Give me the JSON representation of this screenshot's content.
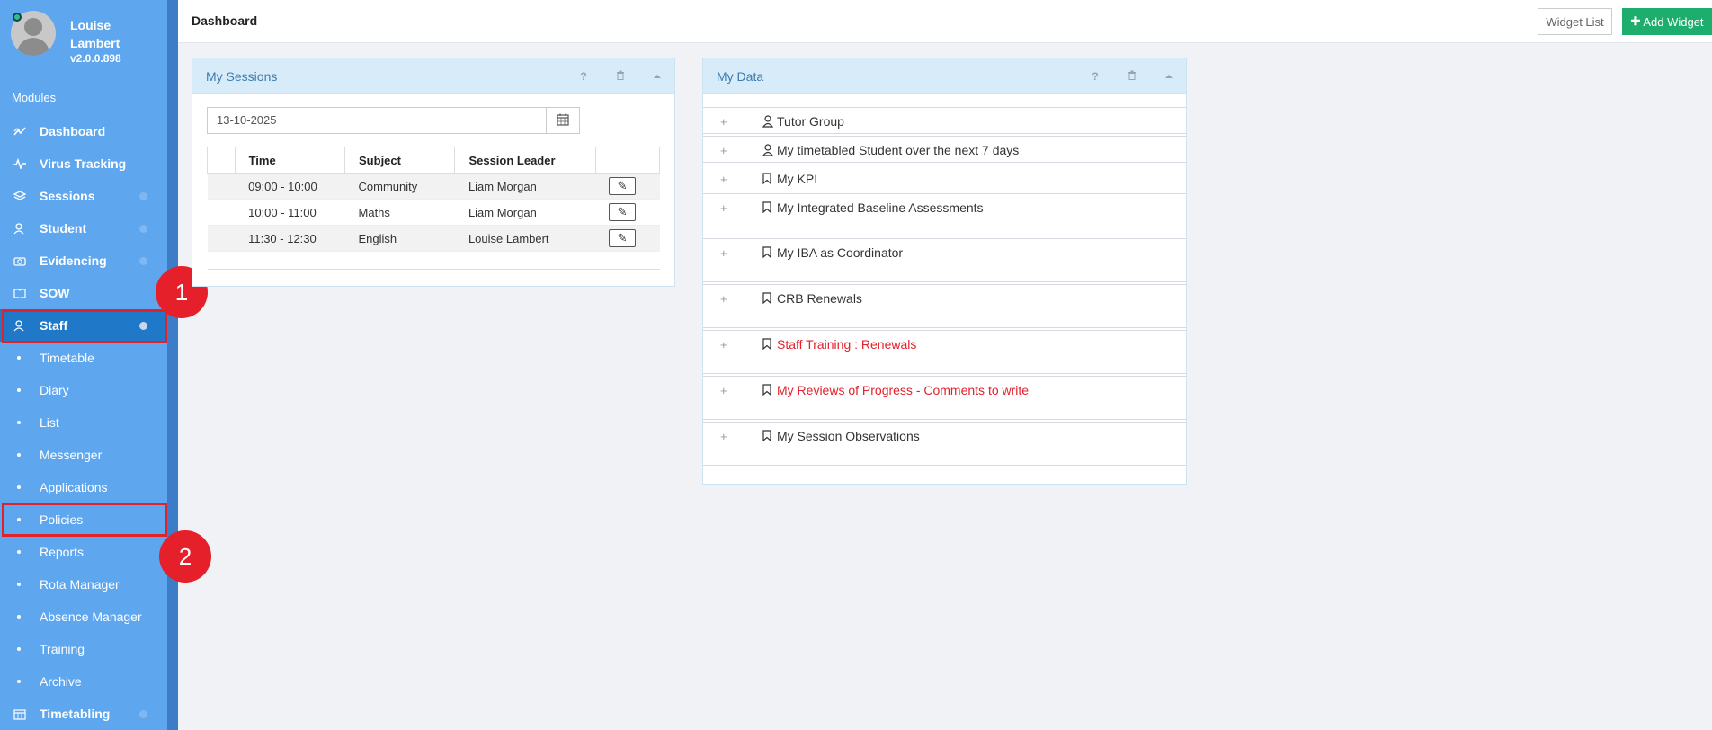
{
  "sidebar": {
    "user_name": "Louise Lambert",
    "version": "v2.0.0.898",
    "modules_label": "Modules",
    "nav": [
      {
        "label": "Dashboard",
        "icon": "chart-line-icon"
      },
      {
        "label": "Virus Tracking",
        "icon": "pulse-icon"
      },
      {
        "label": "Sessions",
        "icon": "layers-icon"
      },
      {
        "label": "Student",
        "icon": "users-icon"
      },
      {
        "label": "Evidencing",
        "icon": "camera-icon"
      },
      {
        "label": "SOW",
        "icon": "book-icon"
      },
      {
        "label": "Staff",
        "icon": "users-icon",
        "active": true
      }
    ],
    "staff_sub": [
      "Timetable",
      "Diary",
      "List",
      "Messenger",
      "Applications",
      "Policies",
      "Reports",
      "Rota Manager",
      "Absence Manager",
      "Training",
      "Archive"
    ],
    "bottom_nav": {
      "label": "Timetabling",
      "icon": "calendar-icon"
    }
  },
  "annotations": {
    "badge1": "1",
    "badge2": "2"
  },
  "topbar": {
    "title": "Dashboard",
    "widget_list": "Widget List",
    "add_widget": "Add Widget"
  },
  "sessions_panel": {
    "title": "My Sessions",
    "date": "13-10-2025",
    "columns": [
      "Time",
      "Subject",
      "Session Leader"
    ],
    "rows": [
      {
        "time": "09:00 - 10:00",
        "subject": "Community",
        "leader": "Liam Morgan"
      },
      {
        "time": "10:00 - 11:00",
        "subject": "Maths",
        "leader": "Liam Morgan"
      },
      {
        "time": "11:30 - 12:30",
        "subject": "English",
        "leader": "Louise Lambert"
      }
    ]
  },
  "data_panel": {
    "title": "My Data",
    "items": [
      {
        "label": "Tutor Group",
        "icon": "user-icon",
        "color": "#333333"
      },
      {
        "label": "My timetabled Student over the next 7 days",
        "icon": "user-icon",
        "color": "#333333"
      },
      {
        "label": "My KPI",
        "icon": "bookmark-icon",
        "color": "#333333"
      },
      {
        "label": "My Integrated Baseline Assessments",
        "icon": "bookmark-icon",
        "color": "#333333"
      },
      {
        "label": "My IBA as Coordinator",
        "icon": "bookmark-icon",
        "color": "#333333"
      },
      {
        "label": "CRB Renewals",
        "icon": "bookmark-icon",
        "color": "#333333"
      },
      {
        "label": "Staff Training : Renewals",
        "icon": "bookmark-icon",
        "color": "#e2222c"
      },
      {
        "label": "My Reviews of Progress - Comments to write",
        "icon": "bookmark-icon",
        "color": "#e2222c"
      },
      {
        "label": "My Session Observations",
        "icon": "bookmark-icon",
        "color": "#333333"
      }
    ]
  },
  "colors": {
    "sidebar": "#5ea6ee",
    "active": "#1f78c8",
    "accent_green": "#1dad6c",
    "highlight_red": "#e0222b"
  }
}
